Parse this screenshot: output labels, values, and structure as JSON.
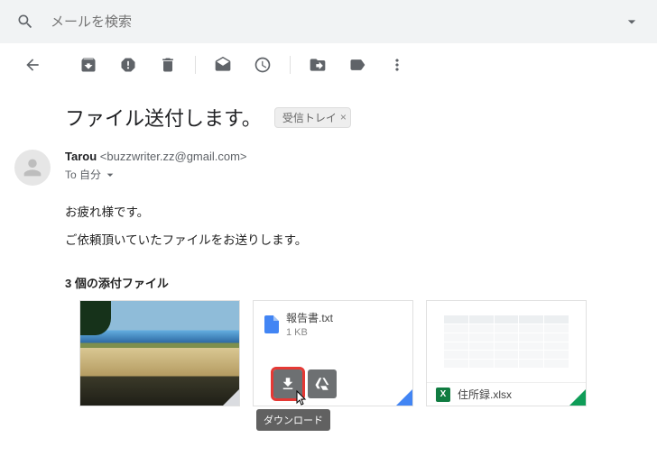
{
  "search": {
    "placeholder": "メールを検索"
  },
  "subject": "ファイル送付します。",
  "inbox_label": "受信トレイ",
  "sender": {
    "name": "Tarou",
    "email": "<buzzwriter.zz@gmail.com>",
    "to_line": "To 自分"
  },
  "body": {
    "line1": "お疲れ様です。",
    "line2": "ご依頼頂いていたファイルをお送りします。"
  },
  "attachments": {
    "heading": "3 個の添付ファイル",
    "txt": {
      "name": "報告書.txt",
      "size": "1 KB"
    },
    "xlsx": {
      "name": "住所録.xlsx",
      "logo": "X"
    }
  },
  "tooltip": {
    "download": "ダウンロード"
  }
}
